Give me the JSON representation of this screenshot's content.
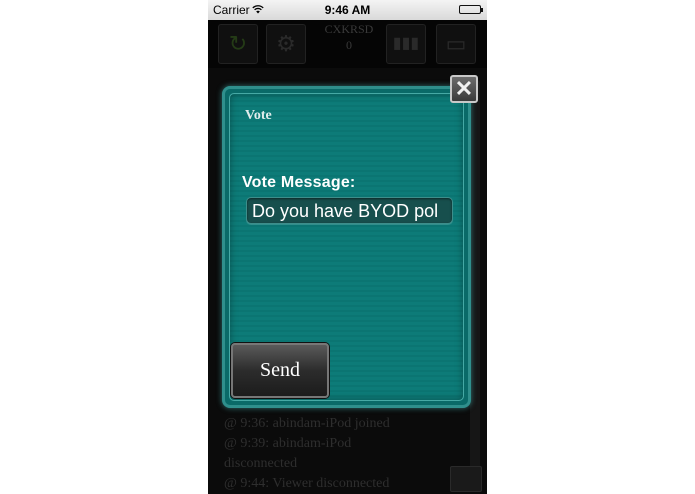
{
  "status_bar": {
    "carrier": "Carrier",
    "time": "9:46 AM"
  },
  "toolbar": {
    "refresh_icon": "refresh-icon",
    "settings_icon": "gear-icon",
    "session_code": "CXKRSD",
    "viewer_count": "0",
    "stats_icon": "bar-chart-icon",
    "display_icon": "monitor-icon"
  },
  "log": {
    "lines": [
      "@ 9:36: abindam-iPod joined",
      "@ 9:39: abindam-iPod",
      "disconnected",
      "@ 9:44: Viewer disconnected"
    ]
  },
  "modal": {
    "title": "Vote",
    "label": "Vote Message:",
    "input_value": "Do you have BYOD pol",
    "send_label": "Send",
    "close_symbol": "✕"
  },
  "colors": {
    "modal_bg": "#0d7b78",
    "modal_border": "#2f8f8c"
  }
}
